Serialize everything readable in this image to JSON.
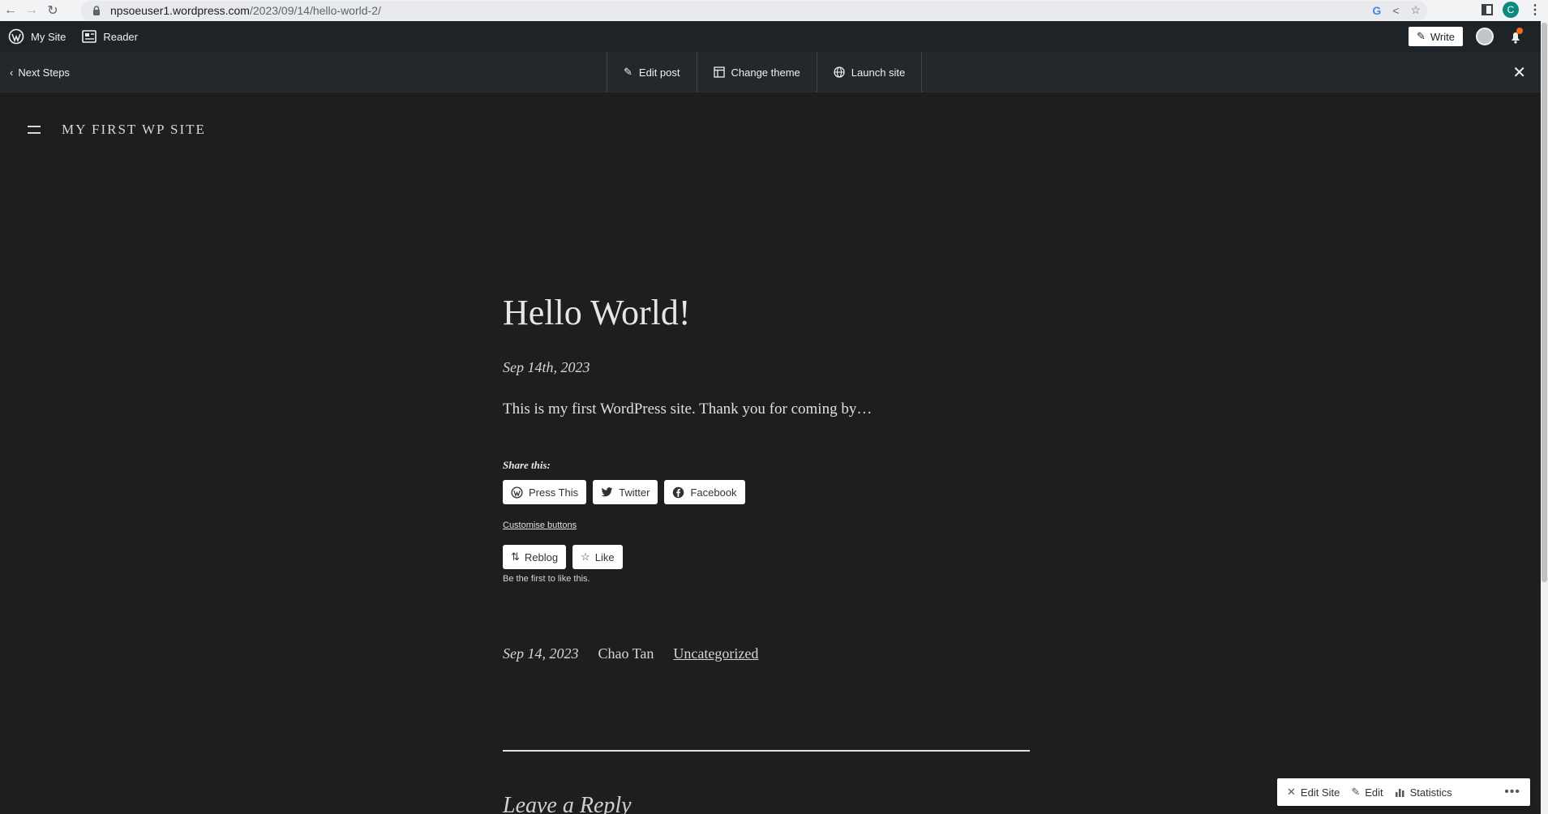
{
  "browser": {
    "url_host": "npsoeuser1.wordpress.com",
    "url_path": "/2023/09/14/hello-world-2/",
    "profile_initial": "C"
  },
  "admin_bar": {
    "my_site": "My Site",
    "reader": "Reader",
    "write": "Write"
  },
  "steps_bar": {
    "back_label": "Next Steps",
    "actions": [
      "Edit post",
      "Change theme",
      "Launch site"
    ]
  },
  "site": {
    "title": "MY FIRST WP SITE"
  },
  "post": {
    "title": "Hello World!",
    "date": "Sep 14th, 2023",
    "body": "This is my first WordPress site. Thank you for coming by…",
    "share_label": "Share this:",
    "share_buttons": [
      "Press This",
      "Twitter",
      "Facebook"
    ],
    "customise": "Customise buttons",
    "reblog": "Reblog",
    "like": "Like",
    "first_like": "Be the first to like this.",
    "meta_date": "Sep 14, 2023",
    "author": "Chao Tan",
    "category": "Uncategorized",
    "reply_title": "Leave a Reply"
  },
  "float_bar": {
    "edit_site": "Edit Site",
    "edit": "Edit",
    "statistics": "Statistics",
    "more": "•••"
  },
  "colors": {
    "background": "#1e1e1e",
    "admin_bar": "#1d2327"
  }
}
